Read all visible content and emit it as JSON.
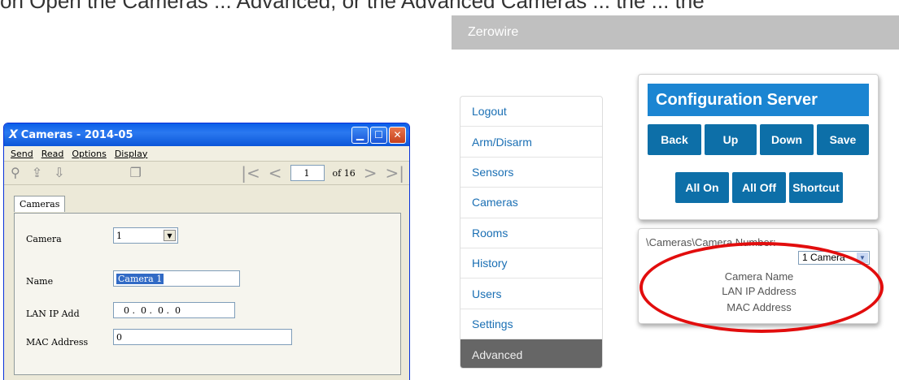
{
  "top_text": "on Open the Cameras ... Advanced, or the Advanced Cameras ... the ... the",
  "dialog": {
    "app_icon": "X",
    "title": "Cameras - 2014-05",
    "menu": [
      "Send",
      "Read",
      "Options",
      "Display"
    ],
    "page": "1",
    "of_pages": "of 16",
    "tab": "Cameras",
    "fields": {
      "camera_label": "Camera",
      "camera_value": "1",
      "name_label": "Name",
      "name_value": "Camera 1",
      "lan_label": "LAN IP Add",
      "lan_value": "0 .  0 .  0 .  0",
      "mac_label": "MAC Address",
      "mac_value": "0"
    }
  },
  "zerowire": {
    "header": "Zerowire",
    "menu": [
      "Logout",
      "Arm/Disarm",
      "Sensors",
      "Cameras",
      "Rooms",
      "History",
      "Users",
      "Settings",
      "Advanced"
    ],
    "panel_title": "Configuration Server",
    "buttons_row1": [
      "Back",
      "Up",
      "Down",
      "Save"
    ],
    "buttons_row2": [
      "All On",
      "All Off",
      "Shortcut"
    ],
    "path": "\\Cameras\\Camera Number:",
    "select_value": "1 Camera",
    "labels": [
      "Camera Name",
      "LAN IP Address",
      "MAC Address"
    ]
  },
  "colors": {
    "accent": "#1b85d2",
    "button": "#0d6fa8",
    "highlight_oval": "#e20d0d",
    "header": "#c0c0c0"
  }
}
